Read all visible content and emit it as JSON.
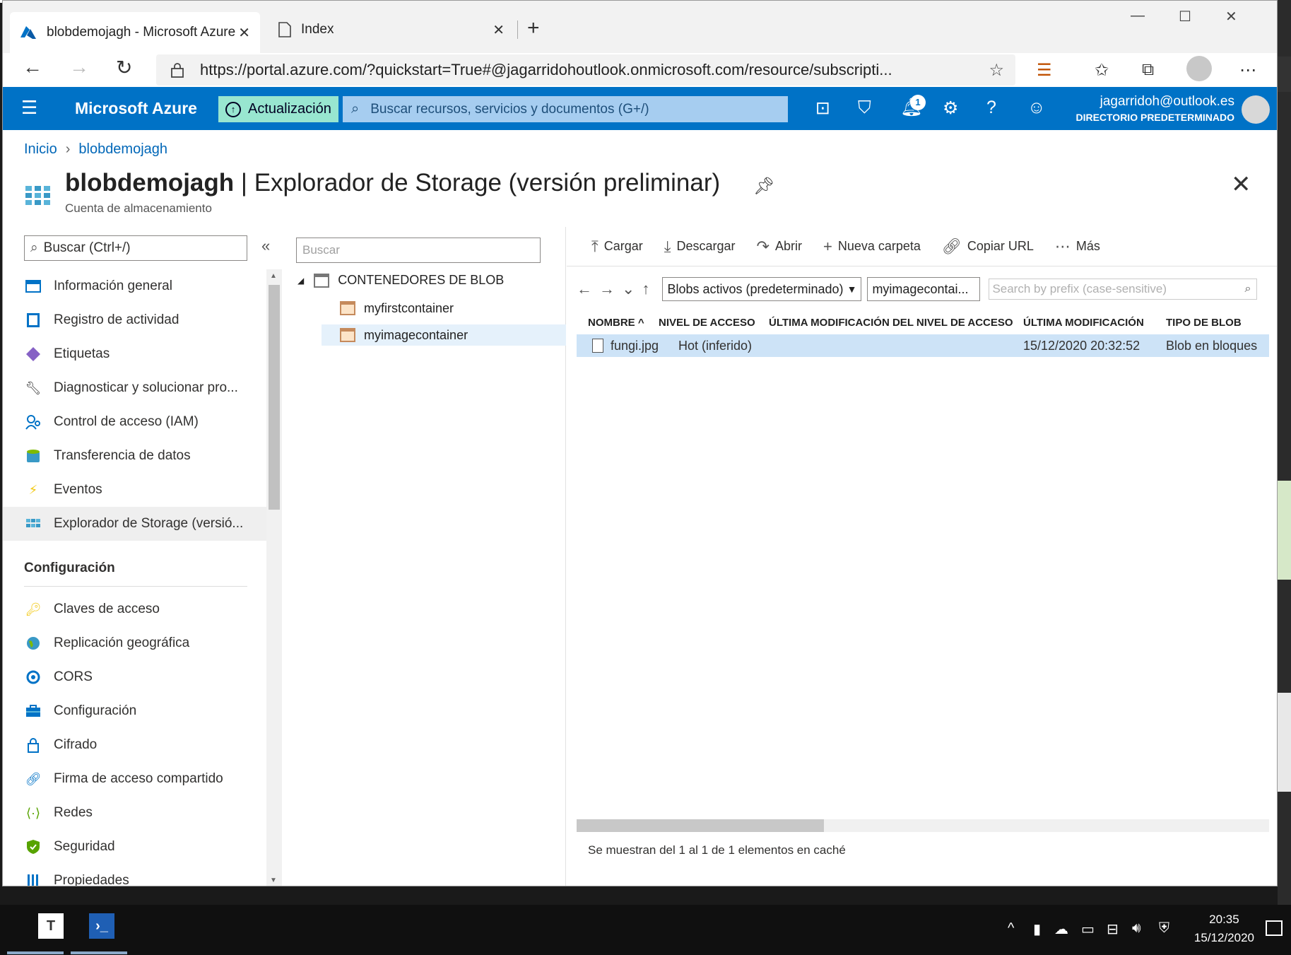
{
  "browser": {
    "tabs": [
      {
        "title": "blobdemojagh - Microsoft Azure",
        "close": "✕"
      },
      {
        "title": "Index",
        "close": "✕"
      }
    ],
    "new_tab": "+",
    "url": "https://portal.azure.com/?quickstart=True#@jagarridohoutlook.onmicrosoft.com/resource/subscripti...",
    "window_controls": {
      "minimize": "—",
      "maximize": "☐",
      "close": "✕"
    }
  },
  "azure": {
    "brand": "Microsoft Azure",
    "update_label": "Actualización",
    "search_placeholder": "Buscar recursos, servicios y documentos (G+/)",
    "notifications_count": "1",
    "user_email": "jagarridoh@outlook.es",
    "user_directory": "DIRECTORIO PREDETERMINADO"
  },
  "breadcrumb": {
    "home": "Inicio",
    "current": "blobdemojagh"
  },
  "page": {
    "resource_name": "blobdemojagh",
    "title_rest": "| Explorador de Storage (versión preliminar)",
    "subtitle": "Cuenta de almacenamiento"
  },
  "leftnav": {
    "search_placeholder": "Buscar (Ctrl+/)",
    "collapse": "«",
    "items": [
      {
        "label": "Información general",
        "icon": "overview-icon"
      },
      {
        "label": "Registro de actividad",
        "icon": "activity-log-icon"
      },
      {
        "label": "Etiquetas",
        "icon": "tag-icon"
      },
      {
        "label": "Diagnosticar y solucionar pro...",
        "icon": "wrench-icon"
      },
      {
        "label": "Control de acceso (IAM)",
        "icon": "people-icon"
      },
      {
        "label": "Transferencia de datos",
        "icon": "bucket-icon"
      },
      {
        "label": "Eventos",
        "icon": "lightning-icon"
      },
      {
        "label": "Explorador de Storage (versió...",
        "icon": "storage-explorer-icon"
      }
    ],
    "section_config": "Configuración",
    "config_items": [
      {
        "label": "Claves de acceso",
        "icon": "key-icon"
      },
      {
        "label": "Replicación geográfica",
        "icon": "globe-icon"
      },
      {
        "label": "CORS",
        "icon": "cors-icon"
      },
      {
        "label": "Configuración",
        "icon": "toolbox-icon"
      },
      {
        "label": "Cifrado",
        "icon": "lock-icon"
      },
      {
        "label": "Firma de acceso compartido",
        "icon": "link-icon"
      },
      {
        "label": "Redes",
        "icon": "network-icon"
      },
      {
        "label": "Seguridad",
        "icon": "shield-icon"
      },
      {
        "label": "Propiedades",
        "icon": "properties-icon"
      }
    ]
  },
  "tree": {
    "search_placeholder": "Buscar",
    "root": "CONTENEDORES DE BLOB",
    "containers": [
      "myfirstcontainer",
      "myimagecontainer"
    ]
  },
  "toolbar": {
    "upload": "Cargar",
    "download": "Descargar",
    "open": "Abrir",
    "new_folder": "Nueva carpeta",
    "copy_url": "Copiar URL",
    "more": "Más"
  },
  "explorer": {
    "view_dropdown": "Blobs activos (predeterminado)",
    "path": "myimagecontai...",
    "prefix_placeholder": "Search by prefix (case-sensitive)",
    "columns": [
      "NOMBRE",
      "NIVEL DE ACCESO",
      "ÚLTIMA MODIFICACIÓN DEL NIVEL DE ACCESO",
      "ÚLTIMA MODIFICACIÓN",
      "TIPO DE BLOB"
    ],
    "rows": [
      {
        "name": "fungi.jpg",
        "access_tier": "Hot (inferido)",
        "tier_modified": "",
        "modified": "15/12/2020 20:32:52",
        "blob_type": "Blob en bloques"
      }
    ],
    "status": "Se muestran del 1 al 1 de 1 elementos en caché"
  },
  "taskbar": {
    "time": "20:35",
    "date": "15/12/2020"
  },
  "colors": {
    "azure_blue": "#0072c6",
    "update_bg": "#98e6d0",
    "selected_row": "#cde3f7"
  }
}
